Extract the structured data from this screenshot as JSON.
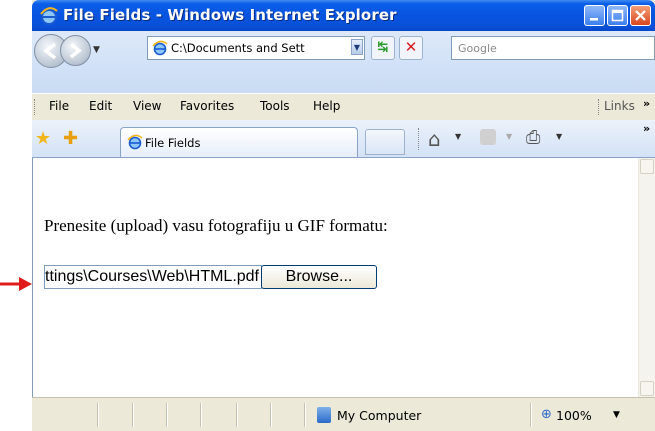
{
  "window": {
    "title": "File Fields - Windows Internet Explorer"
  },
  "navbar": {
    "address": "C:\\Documents and Sett",
    "search_placeholder": "Google"
  },
  "menubar": {
    "items": [
      "File",
      "Edit",
      "View",
      "Favorites",
      "Tools",
      "Help"
    ],
    "links_label": "Links",
    "overflow": "»"
  },
  "tabs": {
    "active_label": "File Fields",
    "overflow": "»"
  },
  "content": {
    "prompt": "Prenesite (upload) vasu fotografiju u GIF formatu:",
    "file_value": "C:\\Documents and Settings\\Courses\\Web\\HTML.pdf",
    "browse_label": "Browse..."
  },
  "statusbar": {
    "zone": "My Computer",
    "zoom": "100%"
  },
  "colors": {
    "titlebar": "#0a5ee8",
    "arrow": "#e01b1b"
  }
}
